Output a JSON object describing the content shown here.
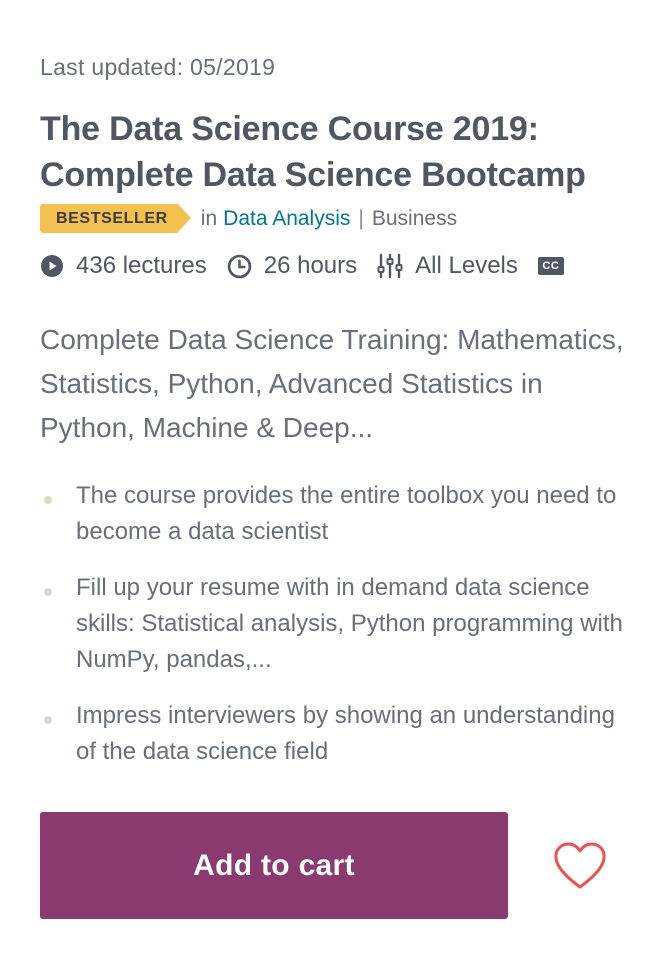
{
  "course": {
    "last_updated": "Last updated: 05/2019",
    "title": "The Data Science Course 2019: Complete Data Science Bootcamp",
    "badge": "BESTSELLER",
    "in_label": "in",
    "category": "Data Analysis",
    "separator": "|",
    "subcategory": "Business",
    "stats": {
      "lectures": "436 lectures",
      "hours": "26 hours",
      "level": "All Levels",
      "cc": "CC"
    },
    "description": "Complete Data Science Training: Mathematics, Statistics, Python, Advanced Statistics in Python, Machine & Deep...",
    "bullets": [
      "The course provides the entire toolbox you need to become a data scientist",
      "Fill up your resume with in demand data science skills: Statistical analysis, Python programming with NumPy, pandas,...",
      "Impress interviewers by showing an understanding of the data science field"
    ],
    "add_to_cart": "Add to cart"
  },
  "icons": {
    "lectures": "play-circle-icon",
    "hours": "clock-icon",
    "level": "sliders-icon",
    "cc": "closed-captions-icon",
    "wishlist": "heart-icon"
  },
  "colors": {
    "text": "#505763",
    "muted": "#686f7a",
    "link": "#007791",
    "badge": "#f4c150",
    "button": "#8a3a6e",
    "heart": "#ec5252"
  }
}
